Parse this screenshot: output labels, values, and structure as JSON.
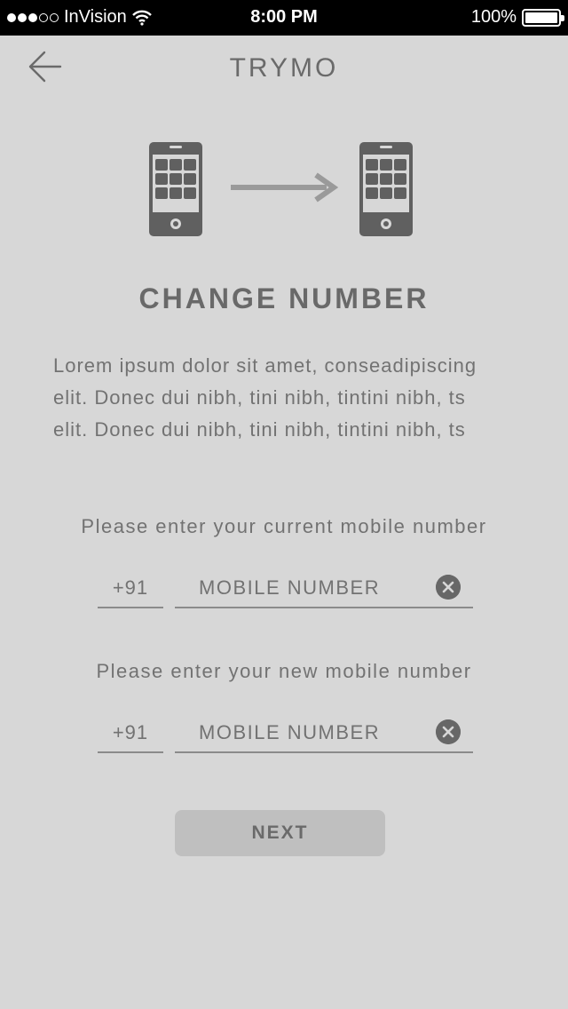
{
  "status_bar": {
    "carrier": "InVision",
    "time": "8:00 PM",
    "battery": "100%",
    "signal_bars_filled": 3,
    "signal_bars_total": 5
  },
  "header": {
    "title": "TRYMO",
    "back_icon": "arrow-left-icon"
  },
  "illustration": {
    "from_icon": "smartphone-icon",
    "arrow_icon": "arrow-right-icon",
    "to_icon": "smartphone-icon"
  },
  "main": {
    "heading": "CHANGE NUMBER",
    "description_lines": [
      "Lorem ipsum dolor sit amet, conseadipiscing",
      "elit. Donec dui nibh, tini nibh, tintini nibh, ts",
      "elit. Donec dui nibh, tini nibh, tintini nibh, ts"
    ]
  },
  "current_number": {
    "prompt": "Please enter your current mobile number",
    "country_code": "+91",
    "placeholder": "MOBILE NUMBER",
    "clear_icon": "clear-circle-icon"
  },
  "new_number": {
    "prompt": "Please enter your new mobile number",
    "country_code": "+91",
    "placeholder": "MOBILE NUMBER",
    "clear_icon": "clear-circle-icon"
  },
  "actions": {
    "next_label": "NEXT"
  },
  "colors": {
    "background": "#d7d7d7",
    "text": "#6d6d6d",
    "icon": "#606060",
    "arrow": "#9a9a9a",
    "button": "#bfbfbf"
  }
}
